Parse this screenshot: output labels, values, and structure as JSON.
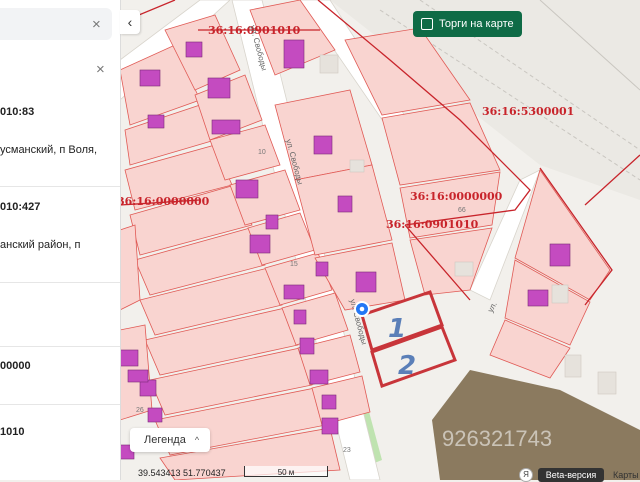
{
  "panel": {
    "close_main": "×",
    "close_card": "×",
    "rows": [
      {
        "text": "010:83",
        "bold": true
      },
      {
        "text": "усманский, п Воля,",
        "bold": false
      },
      {
        "text": "010:427",
        "bold": true
      },
      {
        "text": "анский район, п",
        "bold": false
      },
      {
        "text": "00000",
        "bold": true
      },
      {
        "text": "1010",
        "bold": true
      }
    ]
  },
  "collapse": "‹",
  "torgi_label": "Торги на карте",
  "legend_label": "Легенда",
  "legend_chevron": "^",
  "coords": "39.543413  51.770437",
  "scale_label": "50 м",
  "beta_label": "Beta-версия",
  "maps_label": "Карты",
  "yx_label": "Я",
  "watermark": "926321743",
  "cadastral_labels": [
    "36:16:0901010",
    "36:16:5300001",
    "36:16:0000000",
    "36:16:0000000",
    "36:16:0901010"
  ],
  "street_labels": [
    "ул. Свободы",
    "ул. Свободы",
    "ул. Свободы",
    "ул."
  ],
  "plot_numbers": [
    "1",
    "2"
  ],
  "house_numbers": [
    "10",
    "15",
    "66",
    "26",
    "23"
  ],
  "colors": {
    "parcel_fill": "#f9d4d0",
    "parcel_stroke": "#e05a55",
    "building": "#c44bc0",
    "boundary": "#c8242b",
    "plot_border": "#c8353a",
    "plot_number": "#5b7fb8",
    "marker": "#2477f5",
    "torgi_button": "#0f6b46"
  }
}
